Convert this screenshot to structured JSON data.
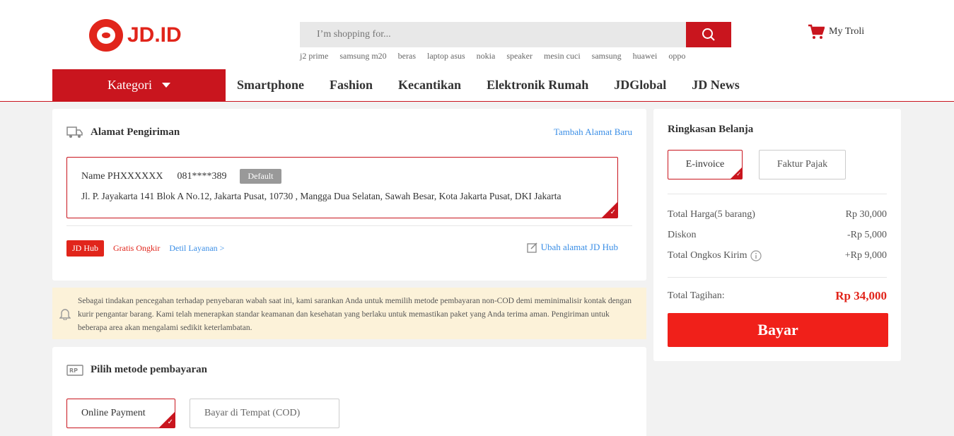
{
  "brand": {
    "logo_text": "JD.ID",
    "accent": "#c9151e"
  },
  "search": {
    "placeholder": "I’m shopping for...",
    "hot_words": [
      "j2 prime",
      "samsung m20",
      "beras",
      "laptop asus",
      "nokia",
      "speaker",
      "mesin cuci",
      "samsung",
      "huawei",
      "oppo"
    ]
  },
  "cart": {
    "label": "My Troli"
  },
  "nav": {
    "kategori": "Kategori",
    "links": [
      "Smartphone",
      "Fashion",
      "Kecantikan",
      "Elektronik Rumah",
      "JDGlobal",
      "JD News"
    ]
  },
  "address": {
    "title": "Alamat Pengiriman",
    "add_new": "Tambah Alamat Baru",
    "name": "Name PHXXXXXX",
    "phone": "081****389",
    "default_badge": "Default",
    "full_address": "Jl. P. Jayakarta 141 Blok A No.12, Jakarta Pusat, 10730 , Mangga Dua Selatan,  Sawah Besar, Kota Jakarta Pusat, DKI Jakarta",
    "hub_badge": "JD Hub",
    "free_shipping": "Gratis Ongkir",
    "service_detail": "Detil Layanan >",
    "change_hub": "Ubah alamat JD Hub"
  },
  "notice": {
    "text": "Sebagai tindakan pencegahan terhadap penyebaran wabah saat ini, kami sarankan Anda untuk memilih metode pembayaran non-COD demi meminimalisir kontak dengan kurir pengantar barang. Kami telah menerapkan standar keamanan dan kesehatan yang berlaku untuk memastikan paket yang Anda terima aman. Pengiriman untuk beberapa area akan mengalami sedikit keterlambatan."
  },
  "payment": {
    "title": "Pilih metode pembayaran",
    "options": [
      "Online Payment",
      "Bayar di Tempat (COD)"
    ]
  },
  "summary": {
    "title": "Ringkasan Belanja",
    "invoice_options": [
      "E-invoice",
      "Faktur Pajak"
    ],
    "rows": [
      {
        "label": "Total Harga(5 barang)",
        "value": "Rp 30,000"
      },
      {
        "label": "Diskon",
        "value": "-Rp 5,000"
      },
      {
        "label": "Total Ongkos Kirim",
        "value": "+Rp 9,000"
      }
    ],
    "total_label": "Total Tagihan:",
    "total_value": "Rp 34,000",
    "pay_button": "Bayar"
  }
}
